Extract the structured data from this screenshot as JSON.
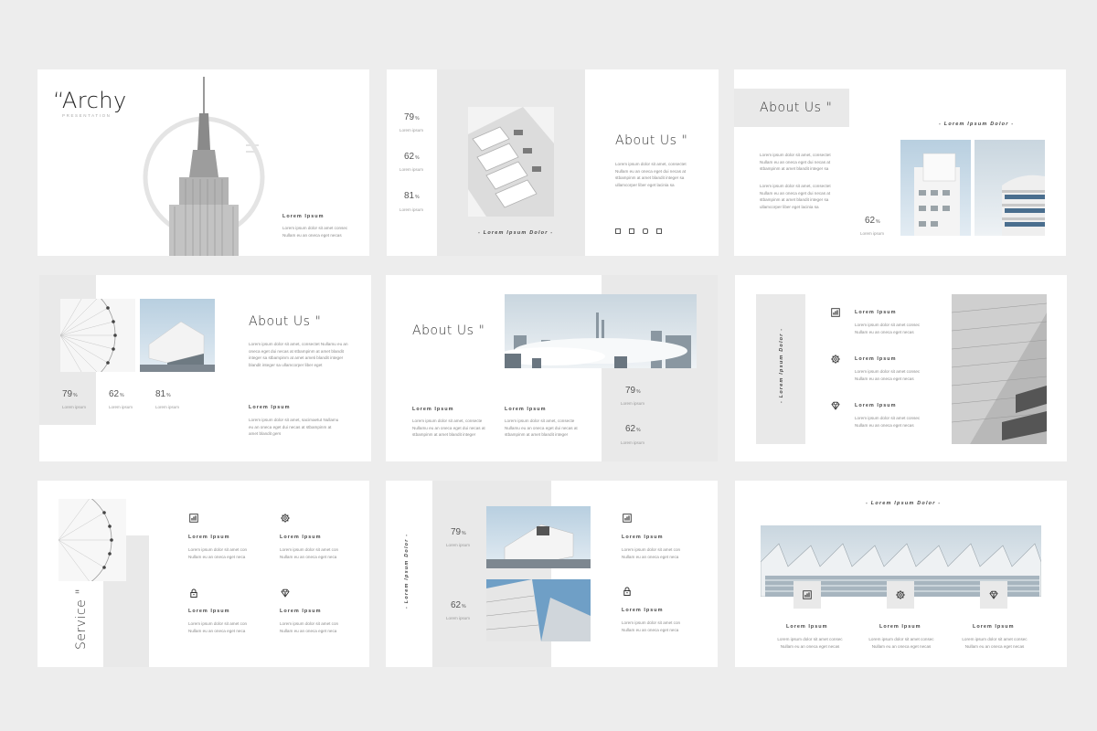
{
  "slide1": {
    "title": "“Archy",
    "subtitle": "PRESENTATION",
    "heading": "Lorem Ipsum",
    "body": "Lorem ipsum dolor sit amet consec Nullam eu an oneca eget necas"
  },
  "slide2": {
    "stats": [
      {
        "value": "79",
        "unit": "%",
        "label": "Lorem ipsum"
      },
      {
        "value": "62",
        "unit": "%",
        "label": "Lorem ipsum"
      },
      {
        "value": "81",
        "unit": "%",
        "label": "Lorem ipsum"
      }
    ],
    "caption": "- Lorem Ipsum Dolor -",
    "title": "About Us \"",
    "body": "Lorem ipsum dolor sit amet, consectet Nullam eu an oneca eget dui necas at stbampinm at amet blandit integer sa ullamcorper liber eget lacinia sa"
  },
  "slide3": {
    "title": "About Us \"",
    "caption": "- Lorem Ipsum Dolor -",
    "body1": "Lorem ipsum dolor sit amet, consectet Nullam eu an oneca eget dui necas at stbampinm at amet blandit integer sa",
    "body2": "Lorem ipsum dolor sit amet, consectet Nullam eu an oneca eget dui necas at stbampinm at amet blandit integer sa ullamcorper liber eget lacinia sa",
    "stat": {
      "value": "62",
      "unit": "%",
      "label": "Lorem ipsum"
    }
  },
  "slide4": {
    "title": "About Us \"",
    "body": "Lorem ipsum dolor sit amet, consectet Nullamu eu an oneca eget dui necas at stbampinm at amet blandit integer sa stbampinm at amet ameti blandit integer blandit integer sa ullamcorper liber eget",
    "stats": [
      {
        "value": "79",
        "unit": "%",
        "label": "Lorem ipsum"
      },
      {
        "value": "62",
        "unit": "%",
        "label": "Lorem ipsum"
      },
      {
        "value": "81",
        "unit": "%",
        "label": "Lorem ipsum"
      }
    ],
    "heading": "Lorem Ipsum",
    "body2": "Lorem ipsum dolor sit amet, sacimaetut Nullamu eu an oneca eget dui necas at stbampinm at amet blandit gers"
  },
  "slide5": {
    "title": "About Us \"",
    "col1_heading": "Lorem Ipsum",
    "col1_body": "Lorem ipsum dolor sit amet, consecte Nullamu eu an oneca eget dui necas at stbampinm at amet blandit integer",
    "col2_heading": "Lorem Ipsum",
    "col2_body": "Lorem ipsum dolor sit amet, consecte Nullamu eu an oneca eget dui necas at stbampinm at amet blandit integer",
    "stats": [
      {
        "value": "79",
        "unit": "%",
        "label": "Lorem ipsum"
      },
      {
        "value": "62",
        "unit": "%",
        "label": "Lorem ipsum"
      }
    ]
  },
  "slide6": {
    "vertical": "- Lorem Ipsum Dolor -",
    "items": [
      {
        "icon": "chart-icon",
        "heading": "Lorem Ipsum",
        "body": "Lorem ipsum dolor sit amet consec Nullam eu an oneca eget necas"
      },
      {
        "icon": "gear-icon",
        "heading": "Lorem Ipsum",
        "body": "Lorem ipsum dolor sit amet consec Nullam eu an oneca eget necas"
      },
      {
        "icon": "diamond-icon",
        "heading": "Lorem Ipsum",
        "body": "Lorem ipsum dolor sit amet consec Nullam eu an oneca eget necas"
      }
    ]
  },
  "slide7": {
    "vertical": "Service \"",
    "items": [
      {
        "icon": "chart-icon",
        "heading": "Lorem Ipsum",
        "body": "Lorem ipsum dolor sit amet con Nullam eu an oneca eget neca"
      },
      {
        "icon": "gear-icon",
        "heading": "Lorem Ipsum",
        "body": "Lorem ipsum dolor sit amet con Nullam eu an oneca eget neca"
      },
      {
        "icon": "lock-icon",
        "heading": "Lorem Ipsum",
        "body": "Lorem ipsum dolor sit amet con Nullam eu an oneca eget neca"
      },
      {
        "icon": "diamond-icon",
        "heading": "Lorem Ipsum",
        "body": "Lorem ipsum dolor sit amet con Nullam eu an oneca eget neca"
      }
    ]
  },
  "slide8": {
    "vertical": "- Lorem Ipsum Dolor -",
    "stats": [
      {
        "value": "79",
        "unit": "%",
        "label": "Lorem ipsum"
      },
      {
        "value": "62",
        "unit": "%",
        "label": "Lorem ipsum"
      }
    ],
    "items": [
      {
        "icon": "chart-icon",
        "heading": "Lorem Ipsum",
        "body": "Lorem ipsum dolor sit amet con Nullam eu an oneca eget neca"
      },
      {
        "icon": "lock-icon",
        "heading": "Lorem Ipsum",
        "body": "Lorem ipsum dolor sit amet con Nullam eu an oneca eget neca"
      }
    ]
  },
  "slide9": {
    "caption": "- Lorem Ipsum Dolor -",
    "items": [
      {
        "icon": "chart-icon",
        "heading": "Lorem Ipsum",
        "body": "Lorem ipsum dolor sit amet consec Nullam eu an oneca eget necas"
      },
      {
        "icon": "gear-icon",
        "heading": "Lorem Ipsum",
        "body": "Lorem ipsum dolor sit amet consec Nullam eu an oneca eget necas"
      },
      {
        "icon": "diamond-icon",
        "heading": "Lorem Ipsum",
        "body": "Lorem ipsum dolor sit amet consec Nullam eu an oneca eget necas"
      }
    ]
  }
}
